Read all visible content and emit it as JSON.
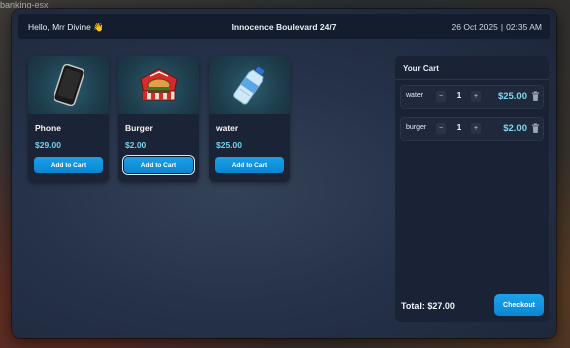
{
  "background_text": "banking-esx",
  "header": {
    "greeting": "Hello, Mrr Divine",
    "greeting_icon": "waving-hand",
    "store_name": "Innocence Boulevard 24/7",
    "date": "26 Oct 2025",
    "separator": "|",
    "time": "02:35 AM"
  },
  "products": [
    {
      "name": "Phone",
      "price": "$29.00",
      "button": "Add to Cart",
      "icon": "phone-icon"
    },
    {
      "name": "Burger",
      "price": "$2.00",
      "button": "Add to Cart",
      "icon": "burger-icon"
    },
    {
      "name": "water",
      "price": "$25.00",
      "button": "Add to Cart",
      "icon": "water-bottle-icon"
    }
  ],
  "cart": {
    "title": "Your Cart",
    "items": [
      {
        "name": "water",
        "qty": "1",
        "price": "$25.00",
        "minus": "−",
        "plus": "+"
      },
      {
        "name": "burger",
        "qty": "1",
        "price": "$2.00",
        "minus": "−",
        "plus": "+"
      }
    ],
    "total": "Total: $27.00",
    "checkout_label": "Checkout"
  },
  "colors": {
    "accent": "#0b8fd9",
    "price": "#6fd1ee",
    "panel": "#1b2436"
  }
}
